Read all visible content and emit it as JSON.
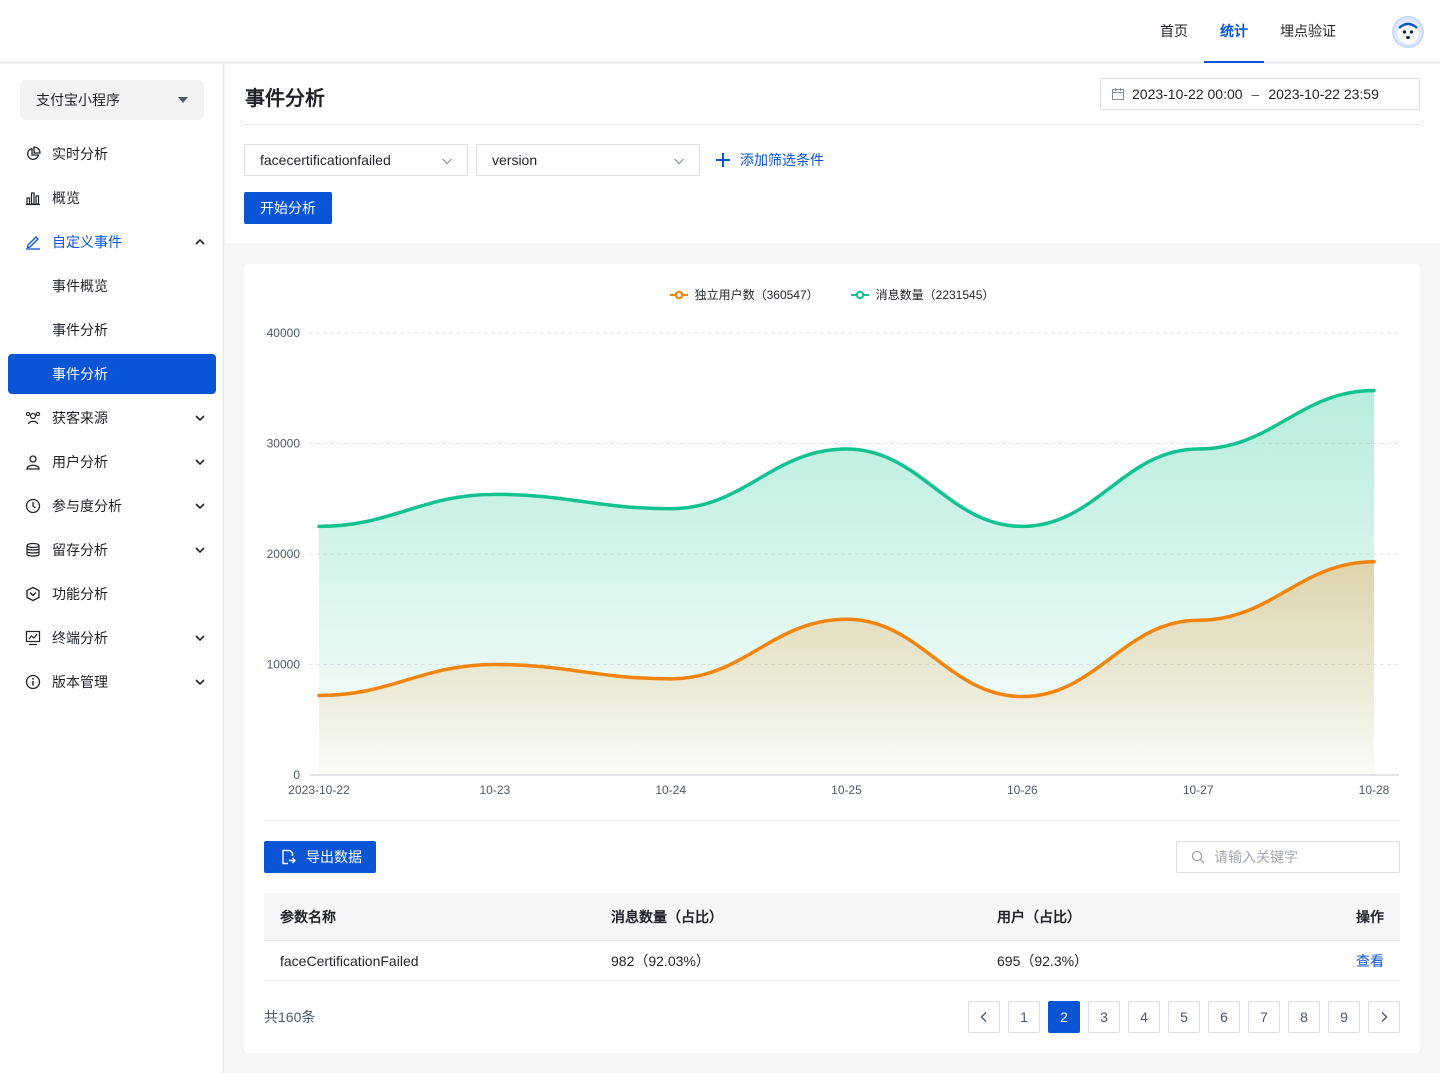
{
  "topnav": {
    "items": [
      {
        "label": "首页",
        "active": false
      },
      {
        "label": "统计",
        "active": true
      },
      {
        "label": "埋点验证",
        "active": false
      }
    ]
  },
  "sidebar": {
    "app_select": "支付宝小程序",
    "menu": [
      {
        "label": "实时分析",
        "icon": "pie-chart-icon"
      },
      {
        "label": "概览",
        "icon": "bar-chart-icon"
      },
      {
        "label": "自定义事件",
        "icon": "edit-icon",
        "expanded": true
      },
      {
        "label": "事件概览",
        "sub": true
      },
      {
        "label": "事件分析",
        "sub": true
      },
      {
        "label": "事件分析",
        "sub": true,
        "selected": true
      },
      {
        "label": "获客来源",
        "icon": "users-icon"
      },
      {
        "label": "用户分析",
        "icon": "user-icon"
      },
      {
        "label": "参与度分析",
        "icon": "clock-icon"
      },
      {
        "label": "留存分析",
        "icon": "database-icon"
      },
      {
        "label": "功能分析",
        "icon": "cube-icon"
      },
      {
        "label": "终端分析",
        "icon": "monitor-icon"
      },
      {
        "label": "版本管理",
        "icon": "info-icon"
      }
    ]
  },
  "page": {
    "title": "事件分析",
    "date_start": "2023-10-22 00:00",
    "date_sep": "–",
    "date_end": "2023-10-22 23:59",
    "event_select": "facecertificationfailed",
    "param_select": "version",
    "add_filter": "添加筛选条件",
    "start_button": "开始分析"
  },
  "chart_data": {
    "type": "area",
    "x": [
      "2023-10-22",
      "10-23",
      "10-24",
      "10-25",
      "10-26",
      "10-27",
      "10-28"
    ],
    "ylim": [
      0,
      40000
    ],
    "yticks": [
      "0",
      "10000",
      "20000",
      "30000",
      "40000"
    ],
    "legend_position": "top-center",
    "grid": true,
    "series": [
      {
        "name": "独立用户数（360547）",
        "color": "#f5840c",
        "values": [
          7200,
          10000,
          8700,
          14100,
          7100,
          14000,
          19300
        ]
      },
      {
        "name": "消息数量（2231545）",
        "color": "#12c291",
        "values": [
          22500,
          25400,
          24100,
          29500,
          22500,
          29500,
          34800
        ]
      }
    ]
  },
  "table": {
    "export_button": "导出数据",
    "search_placeholder": "请输入关键字",
    "headers": [
      "参数名称",
      "消息数量（占比）",
      "用户（占比）",
      "操作"
    ],
    "rows": [
      {
        "name": "faceCertificationFailed",
        "messages": "982（92.03%）",
        "users": "695（92.3%）",
        "action": "查看"
      }
    ],
    "total": "共160条",
    "pages": [
      "1",
      "2",
      "3",
      "4",
      "5",
      "6",
      "7",
      "8",
      "9"
    ],
    "current_page": "2"
  }
}
